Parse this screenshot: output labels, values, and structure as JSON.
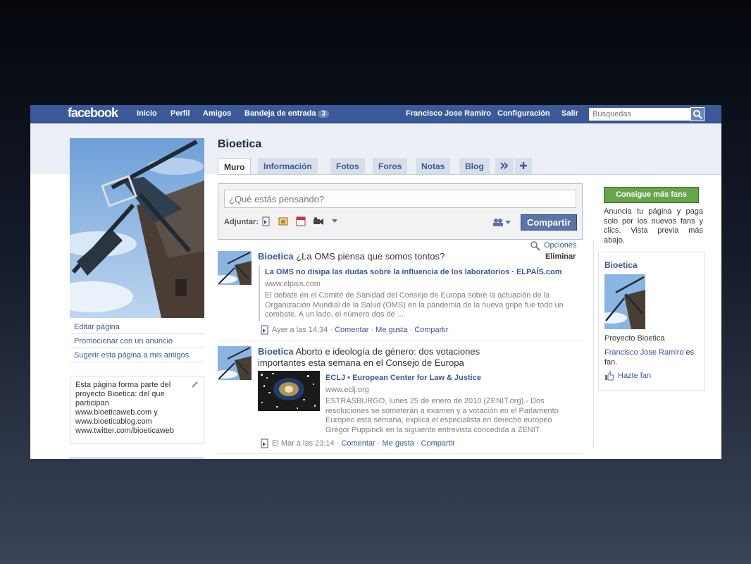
{
  "topbar": {
    "logo": "facebook",
    "nav": [
      "Inicio",
      "Perfil",
      "Amigos"
    ],
    "inbox_label": "Bandeja de entrada",
    "inbox_count": "3",
    "user_name": "Francisco Jose Ramiro",
    "settings_label": "Configuración",
    "logout_label": "Salir",
    "search_placeholder": "Búsquedas"
  },
  "page": {
    "title": "Bioetica"
  },
  "tabs": [
    "Muro",
    "Información",
    "Fotos",
    "Foros",
    "Notas",
    "Blog"
  ],
  "left": {
    "links": [
      "Editar página",
      "Promocionar con un anuncio",
      "Sugerir esta página a mis amigos"
    ],
    "info_lines": [
      "Esta página forma parte del",
      "proyecto Bioetica: del que",
      "participan",
      "www.bioeticaweb.com y",
      "www.bioeticablog.com",
      "www.twitter.com/bioeticaweb"
    ]
  },
  "composer": {
    "placeholder": "¿Qué estás pensando?",
    "attach_label": "Adjuntar:",
    "share_label": "Compartir"
  },
  "posts": [
    {
      "author": "Bioetica",
      "text": "¿La OMS piensa que somos tontos?",
      "options_label": "Opciones",
      "delete_label": "Eliminar",
      "link_title": "La OMS no disipa las dudas sobre la influencia de los laboratorios · ELPAÍS.com",
      "link_url": "www.elpais.com",
      "desc_lines": [
        "El debate en el Comité de Sanidad del Consejo de Europa sobre la actuación de la",
        "Organización Mundial de la Salud (OMS) en la pandemia de la nueva gripe fue todo un",
        "combate. A un lado, el número dos de ..."
      ],
      "time": "Ayer a las 14:34",
      "actions": [
        "Comentar",
        "Me gusta",
        "Compartir"
      ]
    },
    {
      "author": "Bioetica",
      "text_lines": [
        "Aborto e ideología de género: dos votaciones",
        "importantes esta semana en el Consejo de Europa"
      ],
      "link_title": "ECLJ • European Center for Law & Justice",
      "link_url": "www.eclj.org",
      "desc_lines": [
        "ESTRASBURGO, lunes 25 de enero de 2010 (ZENIT.org).- Dos",
        "resoluciones se someterán a examen y a votación en el Parlamento",
        "Europeo esta semana, explica el especialista en derecho europeo",
        "Grégor Puppinck en la siguiente entrevista concedida a ZENIT."
      ],
      "time": "El Mar a las 23:14",
      "actions": [
        "Comentar",
        "Me gusta",
        "Compartir"
      ]
    }
  ],
  "right": {
    "fans_button": "Consigue más fans",
    "fans_desc": "Anuncia tu página y paga solo por los nuevos fans y clics. Vista previa más abajo.",
    "ad_title": "Bioetica",
    "ad_subtitle": "Proyecto Bioetica",
    "ad_fan_name": "Francisco Jose Ramiro",
    "ad_fan_suffix": " es",
    "ad_fan_line2": "fan.",
    "ad_fan_button": "Hazte fan"
  },
  "colors": {
    "brand": "#3b5998",
    "tab_bg": "#d8dfea",
    "green_button": "#67a54b"
  }
}
